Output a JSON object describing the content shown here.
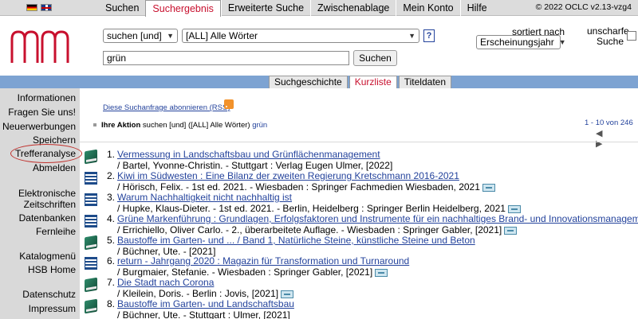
{
  "nav": {
    "tabs": [
      {
        "label": "Suchen"
      },
      {
        "label": "Suchergebnis"
      },
      {
        "label": "Erweiterte Suche"
      },
      {
        "label": "Zwischenablage"
      },
      {
        "label": "Mein Konto"
      },
      {
        "label": "Hilfe"
      }
    ],
    "active_tab": "Suchergebnis",
    "copyright": "© 2022 OCLC v2.13-vzg4"
  },
  "search": {
    "operator": "suchen [und]",
    "field": "[ALL] Alle Wörter",
    "help_label": "?",
    "query": "grün",
    "button_label": "Suchen",
    "sort_label": "sortiert nach",
    "sort_value": "Erscheinungsjahr",
    "fuzzy_label_1": "unscharfe",
    "fuzzy_label_2": "Suche"
  },
  "view_tabs": [
    {
      "label": "Suchgeschichte"
    },
    {
      "label": "Kurzliste"
    },
    {
      "label": "Titeldaten"
    }
  ],
  "sidebar": {
    "items": [
      {
        "label": "Informationen"
      },
      {
        "label": "Fragen Sie uns!"
      },
      {
        "label": "Neuerwerbungen"
      },
      {
        "label": "Speichern"
      },
      {
        "label": "Trefferanalyse"
      },
      {
        "label": "Abmelden"
      },
      {
        "label": "Elektronische"
      },
      {
        "label": "Zeitschriften"
      },
      {
        "label": "Datenbanken"
      },
      {
        "label": "Fernleihe"
      },
      {
        "label": "Katalogmenü"
      },
      {
        "label": "HSB Home"
      },
      {
        "label": "Datenschutz"
      },
      {
        "label": "Impressum"
      }
    ]
  },
  "main": {
    "rss_label": "Diese Suchanfrage abonnieren (RSS)",
    "action_label": "Ihre Aktion",
    "action_text": "suchen [und] ([ALL] Alle Wörter)",
    "action_term": "grün",
    "pager": "1 - 10 von 246",
    "pager_arrows": "◀ ▶"
  },
  "results": [
    {
      "num": "1.",
      "type": "book",
      "title": "Vermessung in Landschaftsbau und Grünflächenmanagement",
      "desc": "/ Bartel, Yvonne-Christin. - Stuttgart : Verlag Eugen Ulmer, [2022]",
      "ebook": false
    },
    {
      "num": "2.",
      "type": "journal",
      "title": "Kiwi im Südwesten : Eine Bilanz der zweiten Regierung Kretschmann 2016-2021",
      "desc": "/ Hörisch, Felix. - 1st ed. 2021. - Wiesbaden : Springer Fachmedien Wiesbaden, 2021",
      "ebook": true
    },
    {
      "num": "3.",
      "type": "journal",
      "title": "Warum Nachhaltigkeit nicht nachhaltig ist",
      "desc": "/ Hupke, Klaus-Dieter. - 1st ed. 2021. - Berlin, Heidelberg : Springer Berlin Heidelberg, 2021",
      "ebook": true
    },
    {
      "num": "4.",
      "type": "journal",
      "title": "Grüne Markenführung : Grundlagen, Erfolgsfaktoren und Instrumente für ein nachhaltiges Brand- und Innovationsmanagement",
      "desc": "/ Errichiello, Oliver Carlo. - 2., überarbeitete Auflage. - Wiesbaden : Springer Gabler, [2021]",
      "ebook": true
    },
    {
      "num": "5.",
      "type": "book",
      "title": "Baustoffe im Garten- und ... / Band 1, Natürliche Steine, künstliche Steine und Beton",
      "desc": "/ Büchner, Ute. - [2021]",
      "ebook": false
    },
    {
      "num": "6.",
      "type": "journal",
      "title": "return - Jahrgang 2020 : Magazin für Transformation und Turnaround",
      "desc": "/ Burgmaier, Stefanie. - Wiesbaden : Springer Gabler, [2021]",
      "ebook": true
    },
    {
      "num": "7.",
      "type": "book",
      "title": "Die Stadt nach Corona",
      "desc": "/ Kleilein, Doris. - Berlin : Jovis, [2021]",
      "ebook": true
    },
    {
      "num": "8.",
      "type": "book",
      "title": "Baustoffe im Garten- und Landschaftsbau",
      "desc": "/ Büchner, Ute. - Stuttgart : Ulmer, [2021]",
      "ebook": false
    }
  ],
  "colors": {
    "accent_red": "#c8102e",
    "link_blue": "#24439c",
    "bar_blue": "#7da3d2",
    "sidebar_grey": "#d9d9d9"
  }
}
